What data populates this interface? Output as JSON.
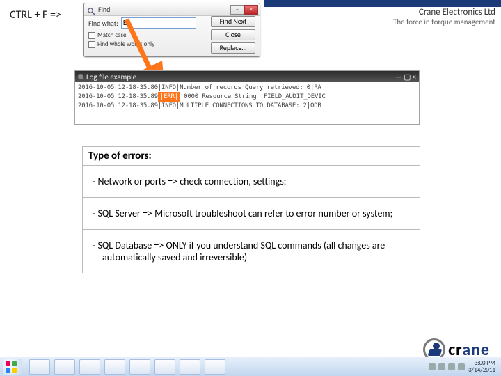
{
  "header": {
    "ctrl_label": "CTRL + F =>",
    "company": "Crane Electronics Ltd",
    "tagline": "The force in torque management"
  },
  "find_dialog": {
    "title": "Find",
    "label_findwhat": "Find what:",
    "input_value": "E",
    "btn_findnext": "Find Next",
    "btn_close": "Close",
    "btn_replace": "Replace…",
    "opt_matchcase": "Match case",
    "opt_wholewords": "Find whole words only"
  },
  "log_panel": {
    "title": "Log file example",
    "lines": [
      "2016-10-05 12-18-35.80|INFO|Number of records Query retrieved: 0|PA",
      "2016-10-05 12-18-35.89",
      "|0000 Resource String 'FIELD_AUDIT_DEVIC",
      "2016-10-05 12-18-35.89|INFO|MULTIPLE CONNECTIONS TO DATABASE: 2|ODB"
    ],
    "error_tag": "|ERR|"
  },
  "errors": {
    "heading": "Type of errors:",
    "items": [
      "-  Network or ports => check connection, settings;",
      "-  SQL Server => Microsoft troubleshoot can refer to error number or system;",
      "-  SQL Database => ONLY if you understand SQL commands (all changes are automatically saved and irreversible)"
    ]
  },
  "logo": {
    "text_dark": "cr",
    "text_blue": "ane"
  },
  "taskbar": {
    "time": "3:00 PM",
    "date": "3/14/2011"
  }
}
